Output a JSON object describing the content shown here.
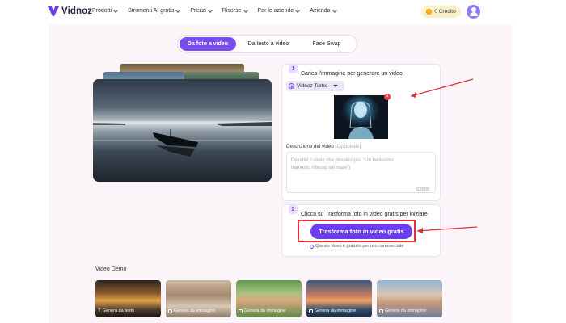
{
  "brand": {
    "name": "Vidnoz"
  },
  "nav": {
    "items": [
      {
        "label": "Prodotti"
      },
      {
        "label": "Strumenti AI gratis"
      },
      {
        "label": "Prezzi"
      },
      {
        "label": "Risorse"
      },
      {
        "label": "Per le aziende"
      },
      {
        "label": "Azienda"
      }
    ],
    "credit_label": "0 Credito"
  },
  "tabs": [
    {
      "label": "Da foto a video",
      "active": true
    },
    {
      "label": "Da testo a video",
      "active": false
    },
    {
      "label": "Face Swap",
      "active": false
    }
  ],
  "step1": {
    "number": "1",
    "title": "Carica l'immagine per generare un video",
    "model": "Vidnoz Turbo",
    "desc_label": "Descrizione del video",
    "desc_optional": "(Opzionale)",
    "desc_placeholder": "Descrivi il video che desideri (es. \"Un bellissimo tramonto riflesso sul mare\")",
    "counter": "0/2000"
  },
  "step2": {
    "number": "2",
    "title": "Clicca su Trasforma foto in video gratis per iniziare",
    "cta": "Trasforma foto in video gratis",
    "note": "Questo video è gratuito per uso commerciale"
  },
  "demo": {
    "title": "Video Demo",
    "items": [
      {
        "label": "Genera da testo"
      },
      {
        "label": "Genera da immagine"
      },
      {
        "label": "Genera da immagine"
      },
      {
        "label": "Genera da immagine"
      },
      {
        "label": "Genera da immagine"
      }
    ]
  },
  "colors": {
    "accent": "#6d3df0",
    "highlight": "#e0303a",
    "background": "#fbf4f8"
  }
}
